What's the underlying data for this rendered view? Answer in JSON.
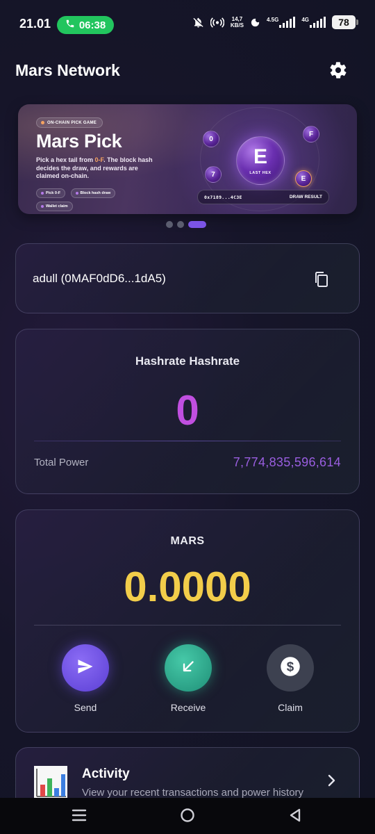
{
  "status_bar": {
    "time": "21.01",
    "call_timer": "06:38",
    "net_speed_value": "14,7",
    "net_speed_unit": "KB/S",
    "signal1_label": "4.5G",
    "signal2_label": "4G",
    "battery": "78",
    "icons": [
      "phone-icon",
      "mute-bell-icon",
      "hotspot-icon",
      "moon-icon"
    ]
  },
  "app": {
    "title": "Mars Network",
    "settings_icon": "gear-icon"
  },
  "banner": {
    "tag": "ON-CHAIN PICK GAME",
    "title": "Mars Pick",
    "desc_before": "Pick a hex tail from ",
    "desc_highlight": "0-F",
    "desc_after": ". The block hash decides the draw, and rewards are claimed on-chain.",
    "chips": [
      "Pick 0-F",
      "Block hash draw",
      "Wallet claim"
    ],
    "big_letter": "E",
    "big_label": "LAST HEX",
    "orbs": [
      "0",
      "F",
      "7",
      "E"
    ],
    "hash": "0x7189...4C3E",
    "draw_label": "DRAW RESULT",
    "active_slide_index": 2,
    "slide_count": 3
  },
  "wallet": {
    "name": "adull (0MAF0dD6...1dA5)",
    "copy_icon": "copy-icon"
  },
  "hashrate": {
    "title": "Hashrate Hashrate",
    "value": "0",
    "power_label": "Total Power",
    "power_value": "7,774,835,596,614"
  },
  "mars": {
    "title": "MARS",
    "balance": "0.0000",
    "actions": [
      {
        "label": "Send",
        "icon": "send-icon"
      },
      {
        "label": "Receive",
        "icon": "receive-arrow-icon"
      },
      {
        "label": "Claim",
        "icon": "dollar-coin-icon"
      }
    ]
  },
  "activity": {
    "title": "Activity",
    "subtitle": "View your recent transactions and power history",
    "icon": "bar-chart-icon"
  },
  "nav": {
    "icons": [
      "menu-icon",
      "home-icon",
      "back-icon"
    ]
  },
  "colors": {
    "accent_purple": "#7b54e6",
    "hashrate_value": "#c04fe0",
    "power_value": "#9a5ee0",
    "balance_gold": "#f2cd4a",
    "receive_green": "#1f8f77",
    "call_green": "#22c55e",
    "banner_orange": "#f5a361"
  }
}
